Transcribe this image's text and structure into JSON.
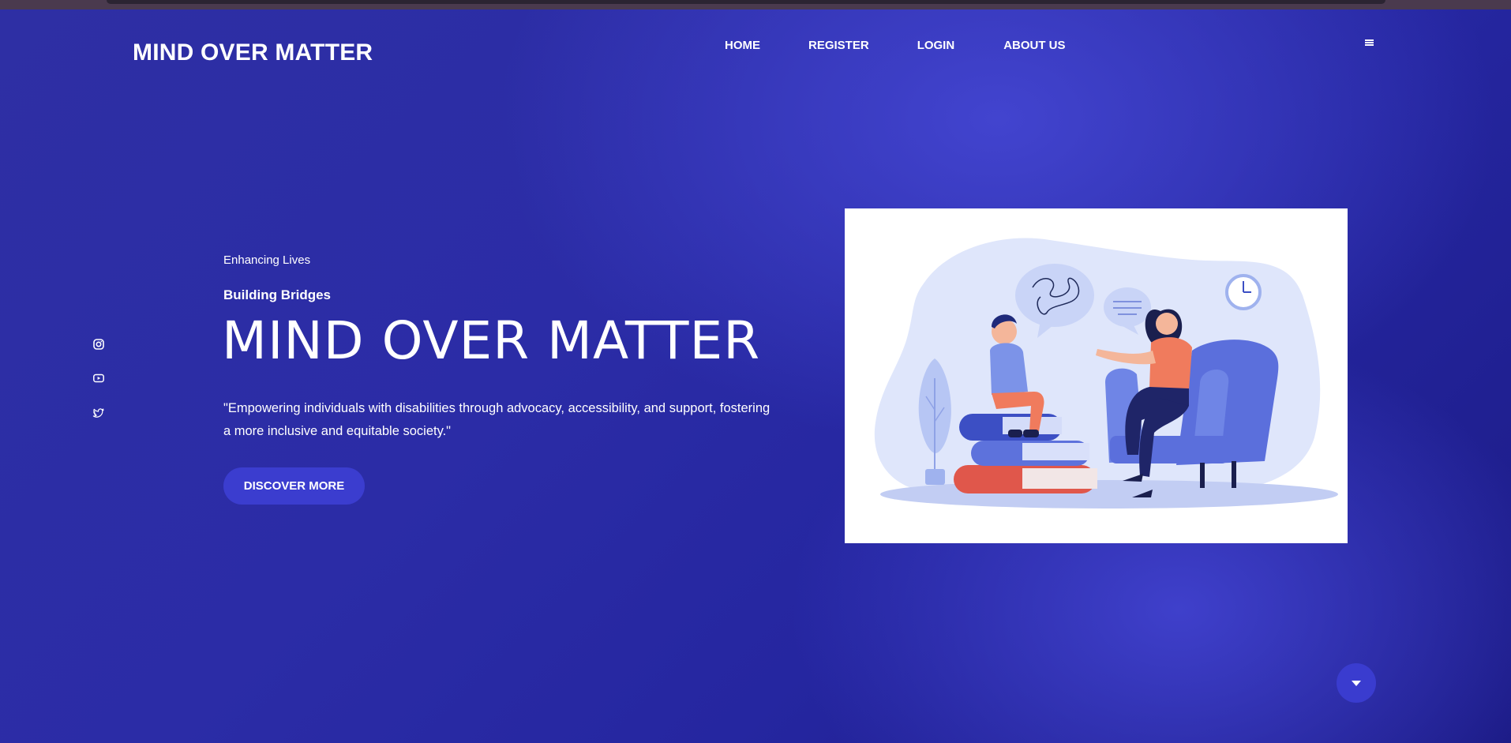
{
  "header": {
    "logo": "MIND OVER MATTER",
    "nav": [
      {
        "label": "HOME"
      },
      {
        "label": "REGISTER"
      },
      {
        "label": "LOGIN"
      },
      {
        "label": "ABOUT US"
      }
    ],
    "menu_icon": "hamburger-icon"
  },
  "social": [
    {
      "icon": "instagram-icon"
    },
    {
      "icon": "youtube-icon"
    },
    {
      "icon": "twitter-icon"
    }
  ],
  "hero": {
    "eyebrow": "Enhancing Lives",
    "subheading": "Building Bridges",
    "title": "MIND OVER MATTER",
    "tagline": "\"Empowering individuals with disabilities through advocacy, accessibility, and support, fostering a more inclusive and equitable society.\"",
    "cta_label": "DISCOVER MORE"
  },
  "scroll_button": {
    "icon": "caret-down-icon"
  },
  "colors": {
    "background": "#2b2ca6",
    "accent": "#3b3dcf",
    "text": "#ffffff"
  }
}
